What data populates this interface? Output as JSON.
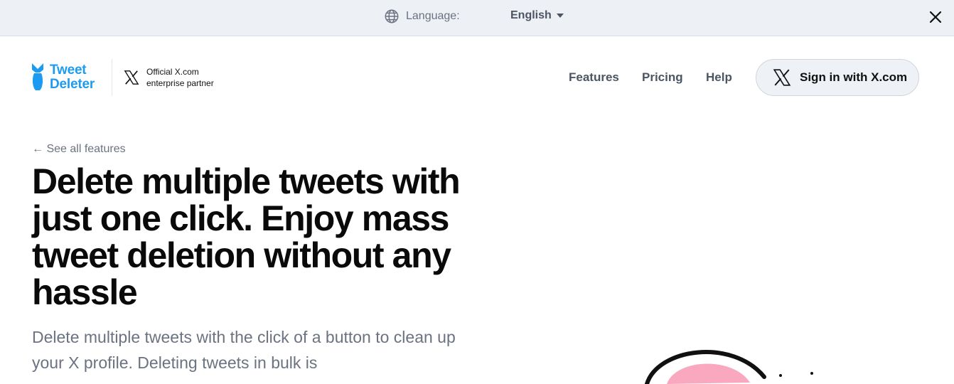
{
  "language_bar": {
    "label": "Language:",
    "selected": "English",
    "globe_icon": "globe-icon",
    "close_icon": "close-icon"
  },
  "header": {
    "logo": {
      "line1": "Tweet",
      "line2": "Deleter",
      "color": "#1d9bf0"
    },
    "partner": {
      "line1": "Official X.com",
      "line2": "enterprise partner"
    },
    "nav": [
      "Features",
      "Pricing",
      "Help"
    ],
    "signin_label": "Sign in with X.com"
  },
  "hero": {
    "back_link": "← See all features",
    "title": "Delete multiple tweets with just one click. Enjoy mass tweet deletion without any hassle",
    "description": "Delete multiple tweets with the click of a button to clean up your X profile. Deleting tweets in bulk is"
  },
  "colors": {
    "accent": "#1d9bf0",
    "topbar": "#edf0f5",
    "muted_text": "#6b7280"
  }
}
